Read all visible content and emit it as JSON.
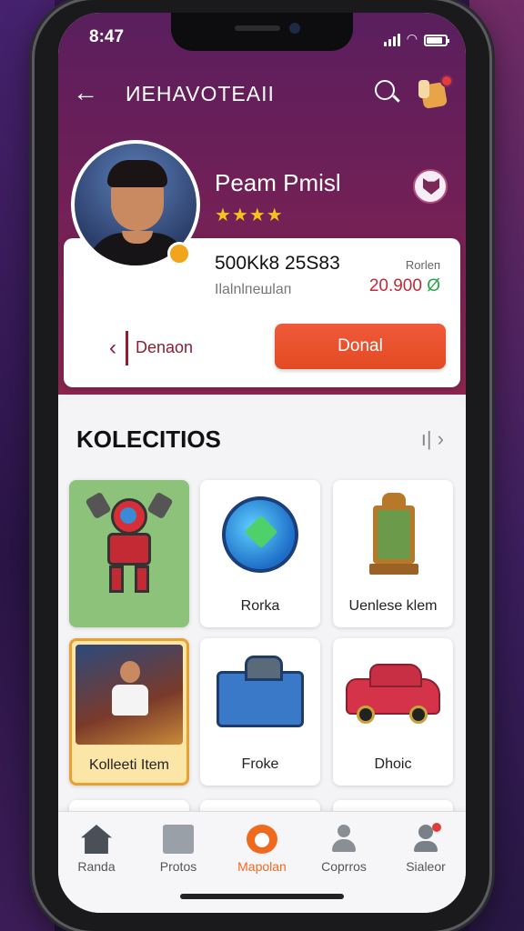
{
  "status": {
    "time": "8:47"
  },
  "appbar": {
    "title": "ИEHAVOTEAII"
  },
  "profile": {
    "name": "Peam Pmisl",
    "stars": "★★★★",
    "stat": "500Kk8 25S83",
    "subtitle": "Ilalnlпешlап",
    "right_label": "Rorleп",
    "right_value": "20.900",
    "right_mark": "Ø"
  },
  "actions": {
    "secondary_label": "Denaon",
    "primary_label": "Donal"
  },
  "collections": {
    "title": "KOLECITIOS",
    "nav": "ı|  ›",
    "items": [
      {
        "label": ""
      },
      {
        "label": "Rorka"
      },
      {
        "label": "Uenlese klem"
      },
      {
        "label": "Kolleeti Item"
      },
      {
        "label": "Froke"
      },
      {
        "label": "Dhoic"
      }
    ]
  },
  "tabs": [
    {
      "label": "Randa",
      "icon": "home-icon"
    },
    {
      "label": "Protos",
      "icon": "mail-icon"
    },
    {
      "label": "Mapolan",
      "icon": "map-icon",
      "active": true
    },
    {
      "label": "Coprros",
      "icon": "people-icon"
    },
    {
      "label": "Sialeor",
      "icon": "profile-icon"
    }
  ],
  "colors": {
    "accent": "#ef6a1f",
    "header": "#6a1f58",
    "primary_button": "#e24a22"
  }
}
